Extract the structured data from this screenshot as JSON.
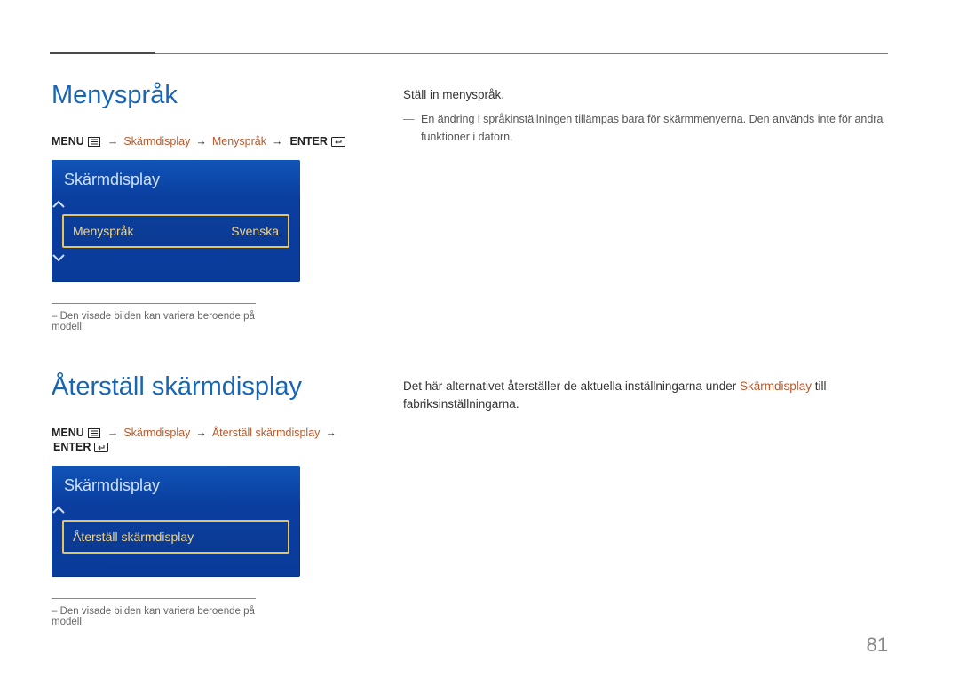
{
  "page_number": "81",
  "section1": {
    "title": "Menyspråk",
    "breadcrumb": {
      "menu": "MENU",
      "items": [
        "Skärmdisplay",
        "Menyspråk"
      ],
      "enter": "ENTER"
    },
    "panel": {
      "title": "Skärmdisplay",
      "row_label": "Menyspråk",
      "row_value": "Svenska"
    },
    "footnote": "Den visade bilden kan variera beroende på modell.",
    "body_text": "Ställ in menyspråk.",
    "body_note": "En ändring i språkinställningen tillämpas bara för skärmmenyerna. Den används inte för andra funktioner i datorn."
  },
  "section2": {
    "title": "Återställ skärmdisplay",
    "breadcrumb": {
      "menu": "MENU",
      "items": [
        "Skärmdisplay",
        "Återställ skärmdisplay"
      ],
      "enter": "ENTER"
    },
    "panel": {
      "title": "Skärmdisplay",
      "row_label": "Återställ skärmdisplay"
    },
    "footnote": "Den visade bilden kan variera beroende på modell.",
    "body_pre": "Det här alternativet återställer de aktuella inställningarna under ",
    "body_accent": "Skärmdisplay",
    "body_post": " till fabriksinställningarna."
  }
}
